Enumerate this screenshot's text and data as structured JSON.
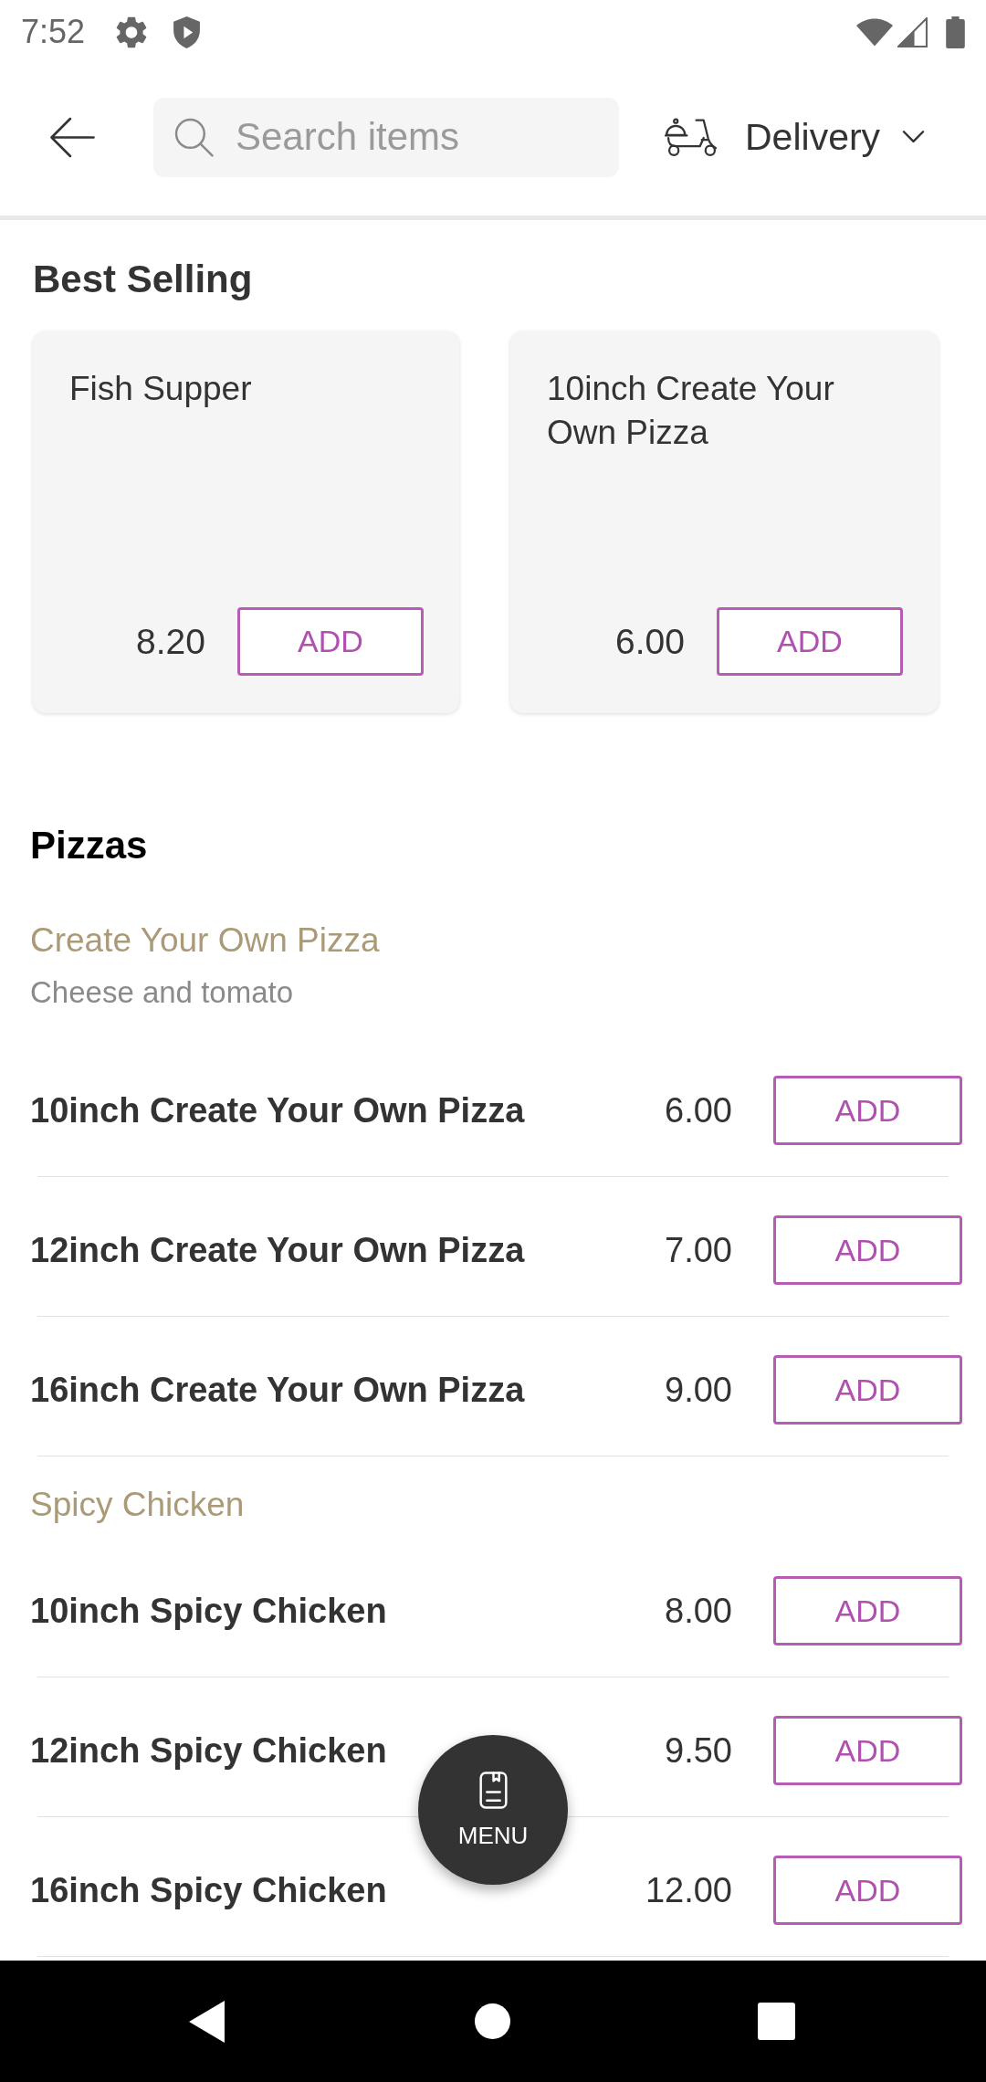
{
  "status_bar": {
    "time": "7:52"
  },
  "header": {
    "search": {
      "placeholder": "Search items"
    },
    "order_mode": {
      "label": "Delivery"
    }
  },
  "best_selling": {
    "title": "Best Selling",
    "items": [
      {
        "name": "Fish Supper",
        "price": "8.20",
        "button": "ADD"
      },
      {
        "name": "10inch Create Your Own Pizza",
        "price": "6.00",
        "button": "ADD"
      }
    ]
  },
  "menu": {
    "title": "Pizzas",
    "groups": [
      {
        "title": "Create Your Own Pizza",
        "description": "Cheese and tomato",
        "items": [
          {
            "name": "10inch Create Your Own Pizza",
            "price": "6.00",
            "button": "ADD"
          },
          {
            "name": "12inch Create Your Own Pizza",
            "price": "7.00",
            "button": "ADD"
          },
          {
            "name": "16inch Create Your Own Pizza",
            "price": "9.00",
            "button": "ADD"
          }
        ]
      },
      {
        "title": "Spicy Chicken",
        "items": [
          {
            "name": "10inch Spicy Chicken",
            "price": "8.00",
            "button": "ADD"
          },
          {
            "name": "12inch Spicy Chicken",
            "price": "9.50",
            "button": "ADD"
          },
          {
            "name": "16inch Spicy Chicken",
            "price": "12.00",
            "button": "ADD"
          }
        ]
      }
    ]
  },
  "fab": {
    "label": "MENU"
  }
}
